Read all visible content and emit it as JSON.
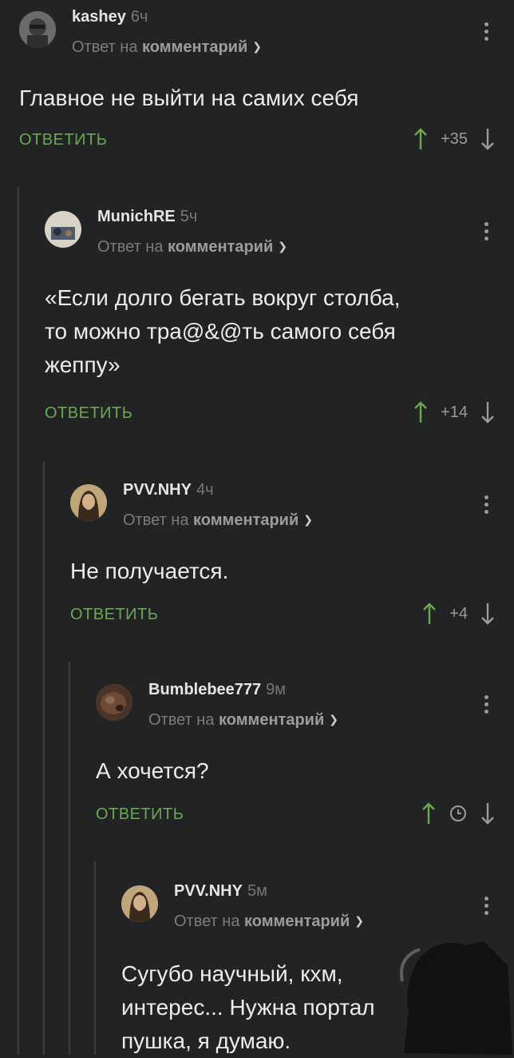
{
  "comments": [
    {
      "username": "kashey",
      "time": "6ч",
      "reply_prefix": "Ответ на",
      "reply_target": "комментарий",
      "text": "Главное не выйти на самих себя",
      "reply_label": "ОТВЕТИТЬ",
      "score": "+35"
    },
    {
      "username": "MunichRE",
      "time": "5ч",
      "reply_prefix": "Ответ на",
      "reply_target": "комментарий",
      "text_lines": [
        "«Если долго бегать вокруг столба,",
        "то можно тра@&@ть самого себя",
        "жеппу»"
      ],
      "reply_label": "ОТВЕТИТЬ",
      "score": "+14"
    },
    {
      "username": "PVV.NHY",
      "time": "4ч",
      "reply_prefix": "Ответ на",
      "reply_target": "комментарий",
      "text": "Не получается.",
      "reply_label": "ОТВЕТИТЬ",
      "score": "+4"
    },
    {
      "username": "Bumblebee777",
      "time": "9м",
      "reply_prefix": "Ответ на",
      "reply_target": "комментарий",
      "text": "А хочется?",
      "reply_label": "ОТВЕТИТЬ",
      "score_icon": "clock-icon"
    },
    {
      "username": "PVV.NHY",
      "time": "5м",
      "reply_prefix": "Ответ на",
      "reply_target": "комментарий",
      "text_lines": [
        "Сугубо научный, кхм,",
        "интерес... Нужна портал",
        "пушка, я думаю."
      ]
    }
  ],
  "colors": {
    "background": "#222325",
    "reply_action": "#6aa94e",
    "upvote": "#6aa94e",
    "muted": "#7b7c7e"
  },
  "icons": [
    "chevron-down-icon",
    "more-vertical-icon",
    "arrow-up-icon",
    "arrow-down-icon",
    "clock-icon"
  ]
}
